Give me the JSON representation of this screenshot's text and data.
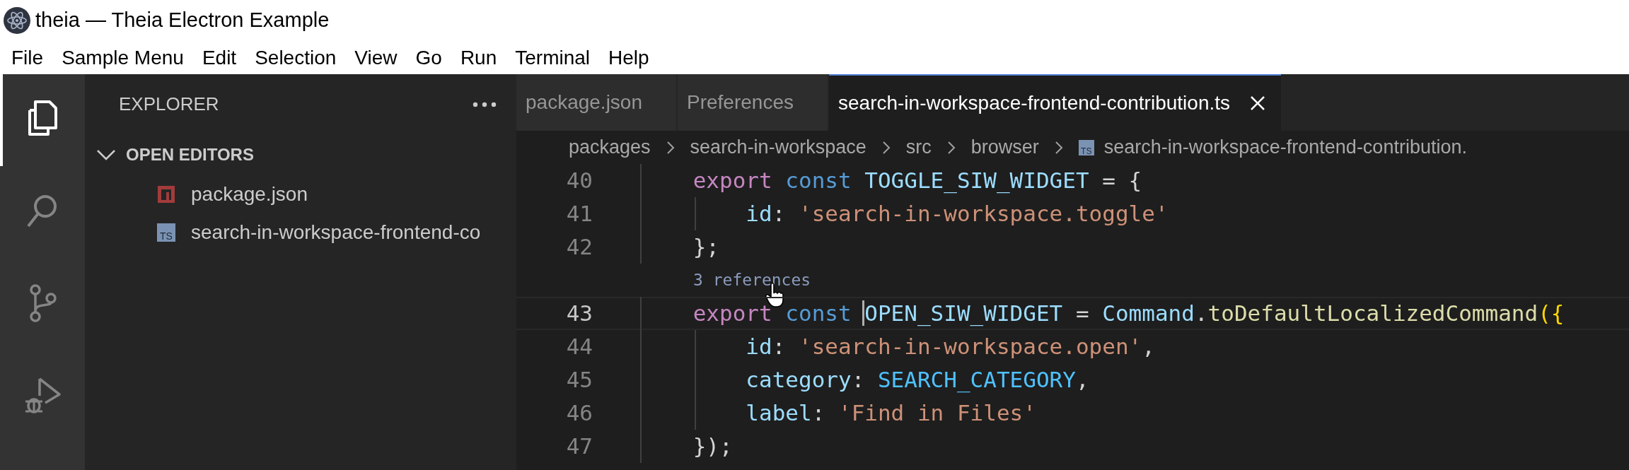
{
  "window": {
    "title": "theia — Theia Electron Example"
  },
  "menu_bar": [
    "File",
    "Sample Menu",
    "Edit",
    "Selection",
    "View",
    "Go",
    "Run",
    "Terminal",
    "Help"
  ],
  "activity_bar": [
    {
      "kind": "explorer",
      "selected": true
    },
    {
      "kind": "search",
      "selected": false
    },
    {
      "kind": "source-control",
      "selected": false
    },
    {
      "kind": "debug",
      "selected": false
    }
  ],
  "sidebar": {
    "title": "EXPLORER",
    "section": {
      "title": "OPEN EDITORS",
      "expanded": true,
      "items": [
        {
          "name": "package.json",
          "kind": "npm"
        },
        {
          "name": "search-in-workspace-frontend-co",
          "kind": "ts",
          "badge": "TS"
        }
      ]
    }
  },
  "tabs": [
    {
      "label": "package.json",
      "selected": false
    },
    {
      "label": "Preferences",
      "selected": false
    },
    {
      "label": "search-in-workspace-frontend-contribution.ts",
      "selected": true
    }
  ],
  "breadcrumbs": [
    {
      "label": "packages"
    },
    {
      "label": "search-in-workspace"
    },
    {
      "label": "src"
    },
    {
      "label": "browser"
    },
    {
      "label": "search-in-workspace-frontend-contribution.",
      "badge": "TS"
    }
  ],
  "editor": {
    "lines": [
      {
        "kind": "code",
        "number": "40",
        "current": false,
        "tokens": [
          {
            "text": "    export",
            "kind": "keyword"
          },
          {
            "text": " const",
            "kind": "storage"
          },
          {
            "text": " TOGGLE_SIW_WIDGET",
            "kind": "variable"
          },
          {
            "text": " = {",
            "kind": "plain"
          }
        ]
      },
      {
        "kind": "code",
        "number": "41",
        "current": false,
        "tokens": [
          {
            "text": "        id",
            "kind": "variable"
          },
          {
            "text": ": ",
            "kind": "plain"
          },
          {
            "text": "'search-in-workspace.toggle'",
            "kind": "string"
          }
        ]
      },
      {
        "kind": "code",
        "number": "42",
        "current": false,
        "tokens": [
          {
            "text": "    };",
            "kind": "plain"
          }
        ]
      },
      {
        "kind": "codelens",
        "text": "3 references"
      },
      {
        "kind": "code",
        "number": "43",
        "current": true,
        "tokens": [
          {
            "text": "    export",
            "kind": "keyword"
          },
          {
            "text": " const ",
            "kind": "storage"
          },
          {
            "text": "OPEN_SIW_WIDGET",
            "kind": "variable",
            "caret": true
          },
          {
            "text": " = ",
            "kind": "plain"
          },
          {
            "text": "Command",
            "kind": "variable"
          },
          {
            "text": ".",
            "kind": "plain"
          },
          {
            "text": "toDefaultLocalizedCommand",
            "kind": "function"
          },
          {
            "text": "({",
            "kind": "bracket"
          }
        ]
      },
      {
        "kind": "code",
        "number": "44",
        "current": false,
        "tokens": [
          {
            "text": "        id",
            "kind": "variable"
          },
          {
            "text": ": ",
            "kind": "plain"
          },
          {
            "text": "'search-in-workspace.open'",
            "kind": "string"
          },
          {
            "text": ",",
            "kind": "plain"
          }
        ]
      },
      {
        "kind": "code",
        "number": "45",
        "current": false,
        "tokens": [
          {
            "text": "        category",
            "kind": "variable"
          },
          {
            "text": ": ",
            "kind": "plain"
          },
          {
            "text": "SEARCH_CATEGORY",
            "kind": "constant"
          },
          {
            "text": ",",
            "kind": "plain"
          }
        ]
      },
      {
        "kind": "code",
        "number": "46",
        "current": false,
        "tokens": [
          {
            "text": "        label",
            "kind": "variable"
          },
          {
            "text": ": ",
            "kind": "plain"
          },
          {
            "text": "'Find in Files'",
            "kind": "string"
          }
        ]
      },
      {
        "kind": "code",
        "number": "47",
        "current": false,
        "tokens": [
          {
            "text": "    });",
            "kind": "plain"
          }
        ]
      }
    ]
  }
}
